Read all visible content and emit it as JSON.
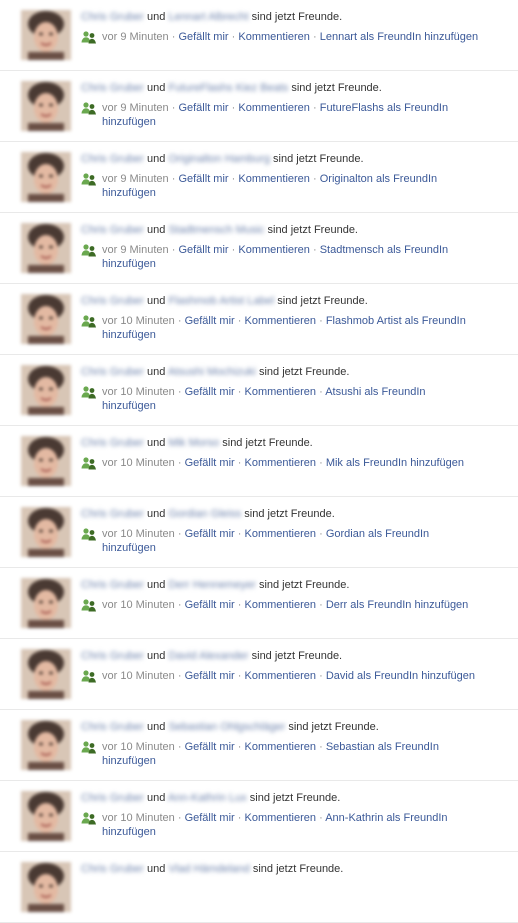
{
  "icons": {
    "story_icon": "friends-added-icon",
    "icon_green": "#6aa84f",
    "icon_dark": "#3d6b25"
  },
  "colors": {
    "link": "#3b5998",
    "muted": "#8a8a8a",
    "divider": "#e9e9e9"
  },
  "stories": [
    {
      "actor": "Chris Gruber",
      "conj": "und",
      "friend": "Lennart Albrecht",
      "suffix": "sind jetzt Freunde.",
      "time": "vor 9 Minuten",
      "sep1": "·",
      "like": "Gefällt mir",
      "sep2": "·",
      "comment": "Kommentieren",
      "sep3": "·",
      "add_friend": "Lennart als FreundIn hinzufügen"
    },
    {
      "actor": "Chris Gruber",
      "conj": "und",
      "friend": "FutureFlashs Kiez Beats",
      "suffix": "sind jetzt Freunde.",
      "time": "vor 9 Minuten",
      "sep1": "·",
      "like": "Gefällt mir",
      "sep2": "·",
      "comment": "Kommentieren",
      "sep3": "·",
      "add_friend": "FutureFlashs als FreundIn hinzufügen"
    },
    {
      "actor": "Chris Gruber",
      "conj": "und",
      "friend": "Originalton Hamburg",
      "suffix": "sind jetzt Freunde.",
      "time": "vor 9 Minuten",
      "sep1": "·",
      "like": "Gefällt mir",
      "sep2": "·",
      "comment": "Kommentieren",
      "sep3": "·",
      "add_friend": "Originalton als FreundIn hinzufügen"
    },
    {
      "actor": "Chris Gruber",
      "conj": "und",
      "friend": "Stadtmensch Music",
      "suffix": "sind jetzt Freunde.",
      "time": "vor 9 Minuten",
      "sep1": "·",
      "like": "Gefällt mir",
      "sep2": "·",
      "comment": "Kommentieren",
      "sep3": "·",
      "add_friend": "Stadtmensch als FreundIn hinzufügen"
    },
    {
      "actor": "Chris Gruber",
      "conj": "und",
      "friend": "Flashmob Artist Label",
      "suffix": "sind jetzt Freunde.",
      "time": "vor 10 Minuten",
      "sep1": "·",
      "like": "Gefällt mir",
      "sep2": "·",
      "comment": "Kommentieren",
      "sep3": "·",
      "add_friend": "Flashmob Artist als FreundIn hinzufügen"
    },
    {
      "actor": "Chris Gruber",
      "conj": "und",
      "friend": "Atsushi Mochizuki",
      "suffix": "sind jetzt Freunde.",
      "time": "vor 10 Minuten",
      "sep1": "·",
      "like": "Gefällt mir",
      "sep2": "·",
      "comment": "Kommentieren",
      "sep3": "·",
      "add_friend": "Atsushi als FreundIn hinzufügen"
    },
    {
      "actor": "Chris Gruber",
      "conj": "und",
      "friend": "Mik Morso",
      "suffix": "sind jetzt Freunde.",
      "time": "vor 10 Minuten",
      "sep1": "·",
      "like": "Gefällt mir",
      "sep2": "·",
      "comment": "Kommentieren",
      "sep3": "·",
      "add_friend": "Mik als FreundIn hinzufügen"
    },
    {
      "actor": "Chris Gruber",
      "conj": "und",
      "friend": "Gordian Gleiss",
      "suffix": "sind jetzt Freunde.",
      "time": "vor 10 Minuten",
      "sep1": "·",
      "like": "Gefällt mir",
      "sep2": "·",
      "comment": "Kommentieren",
      "sep3": "·",
      "add_friend": "Gordian als FreundIn hinzufügen"
    },
    {
      "actor": "Chris Gruber",
      "conj": "und",
      "friend": "Derr Hennemeyer",
      "suffix": "sind jetzt Freunde.",
      "time": "vor 10 Minuten",
      "sep1": "·",
      "like": "Gefällt mir",
      "sep2": "·",
      "comment": "Kommentieren",
      "sep3": "·",
      "add_friend": "Derr als FreundIn hinzufügen"
    },
    {
      "actor": "Chris Gruber",
      "conj": "und",
      "friend": "David Alexander",
      "suffix": "sind jetzt Freunde.",
      "time": "vor 10 Minuten",
      "sep1": "·",
      "like": "Gefällt mir",
      "sep2": "·",
      "comment": "Kommentieren",
      "sep3": "·",
      "add_friend": "David als FreundIn hinzufügen"
    },
    {
      "actor": "Chris Gruber",
      "conj": "und",
      "friend": "Sebastian Ohlgschläger",
      "suffix": "sind jetzt Freunde.",
      "time": "vor 10 Minuten",
      "sep1": "·",
      "like": "Gefällt mir",
      "sep2": "·",
      "comment": "Kommentieren",
      "sep3": "·",
      "add_friend": "Sebastian als FreundIn hinzufügen"
    },
    {
      "actor": "Chris Gruber",
      "conj": "und",
      "friend": "Ann-Kathrin Lux",
      "suffix": "sind jetzt Freunde.",
      "time": "vor 10 Minuten",
      "sep1": "·",
      "like": "Gefällt mir",
      "sep2": "·",
      "comment": "Kommentieren",
      "sep3": "·",
      "add_friend": "Ann-Kathrin als FreundIn hinzufügen"
    },
    {
      "actor": "Chris Gruber",
      "conj": "und",
      "friend": "Vlad Hämdeland",
      "suffix": "sind jetzt Freunde."
    }
  ]
}
